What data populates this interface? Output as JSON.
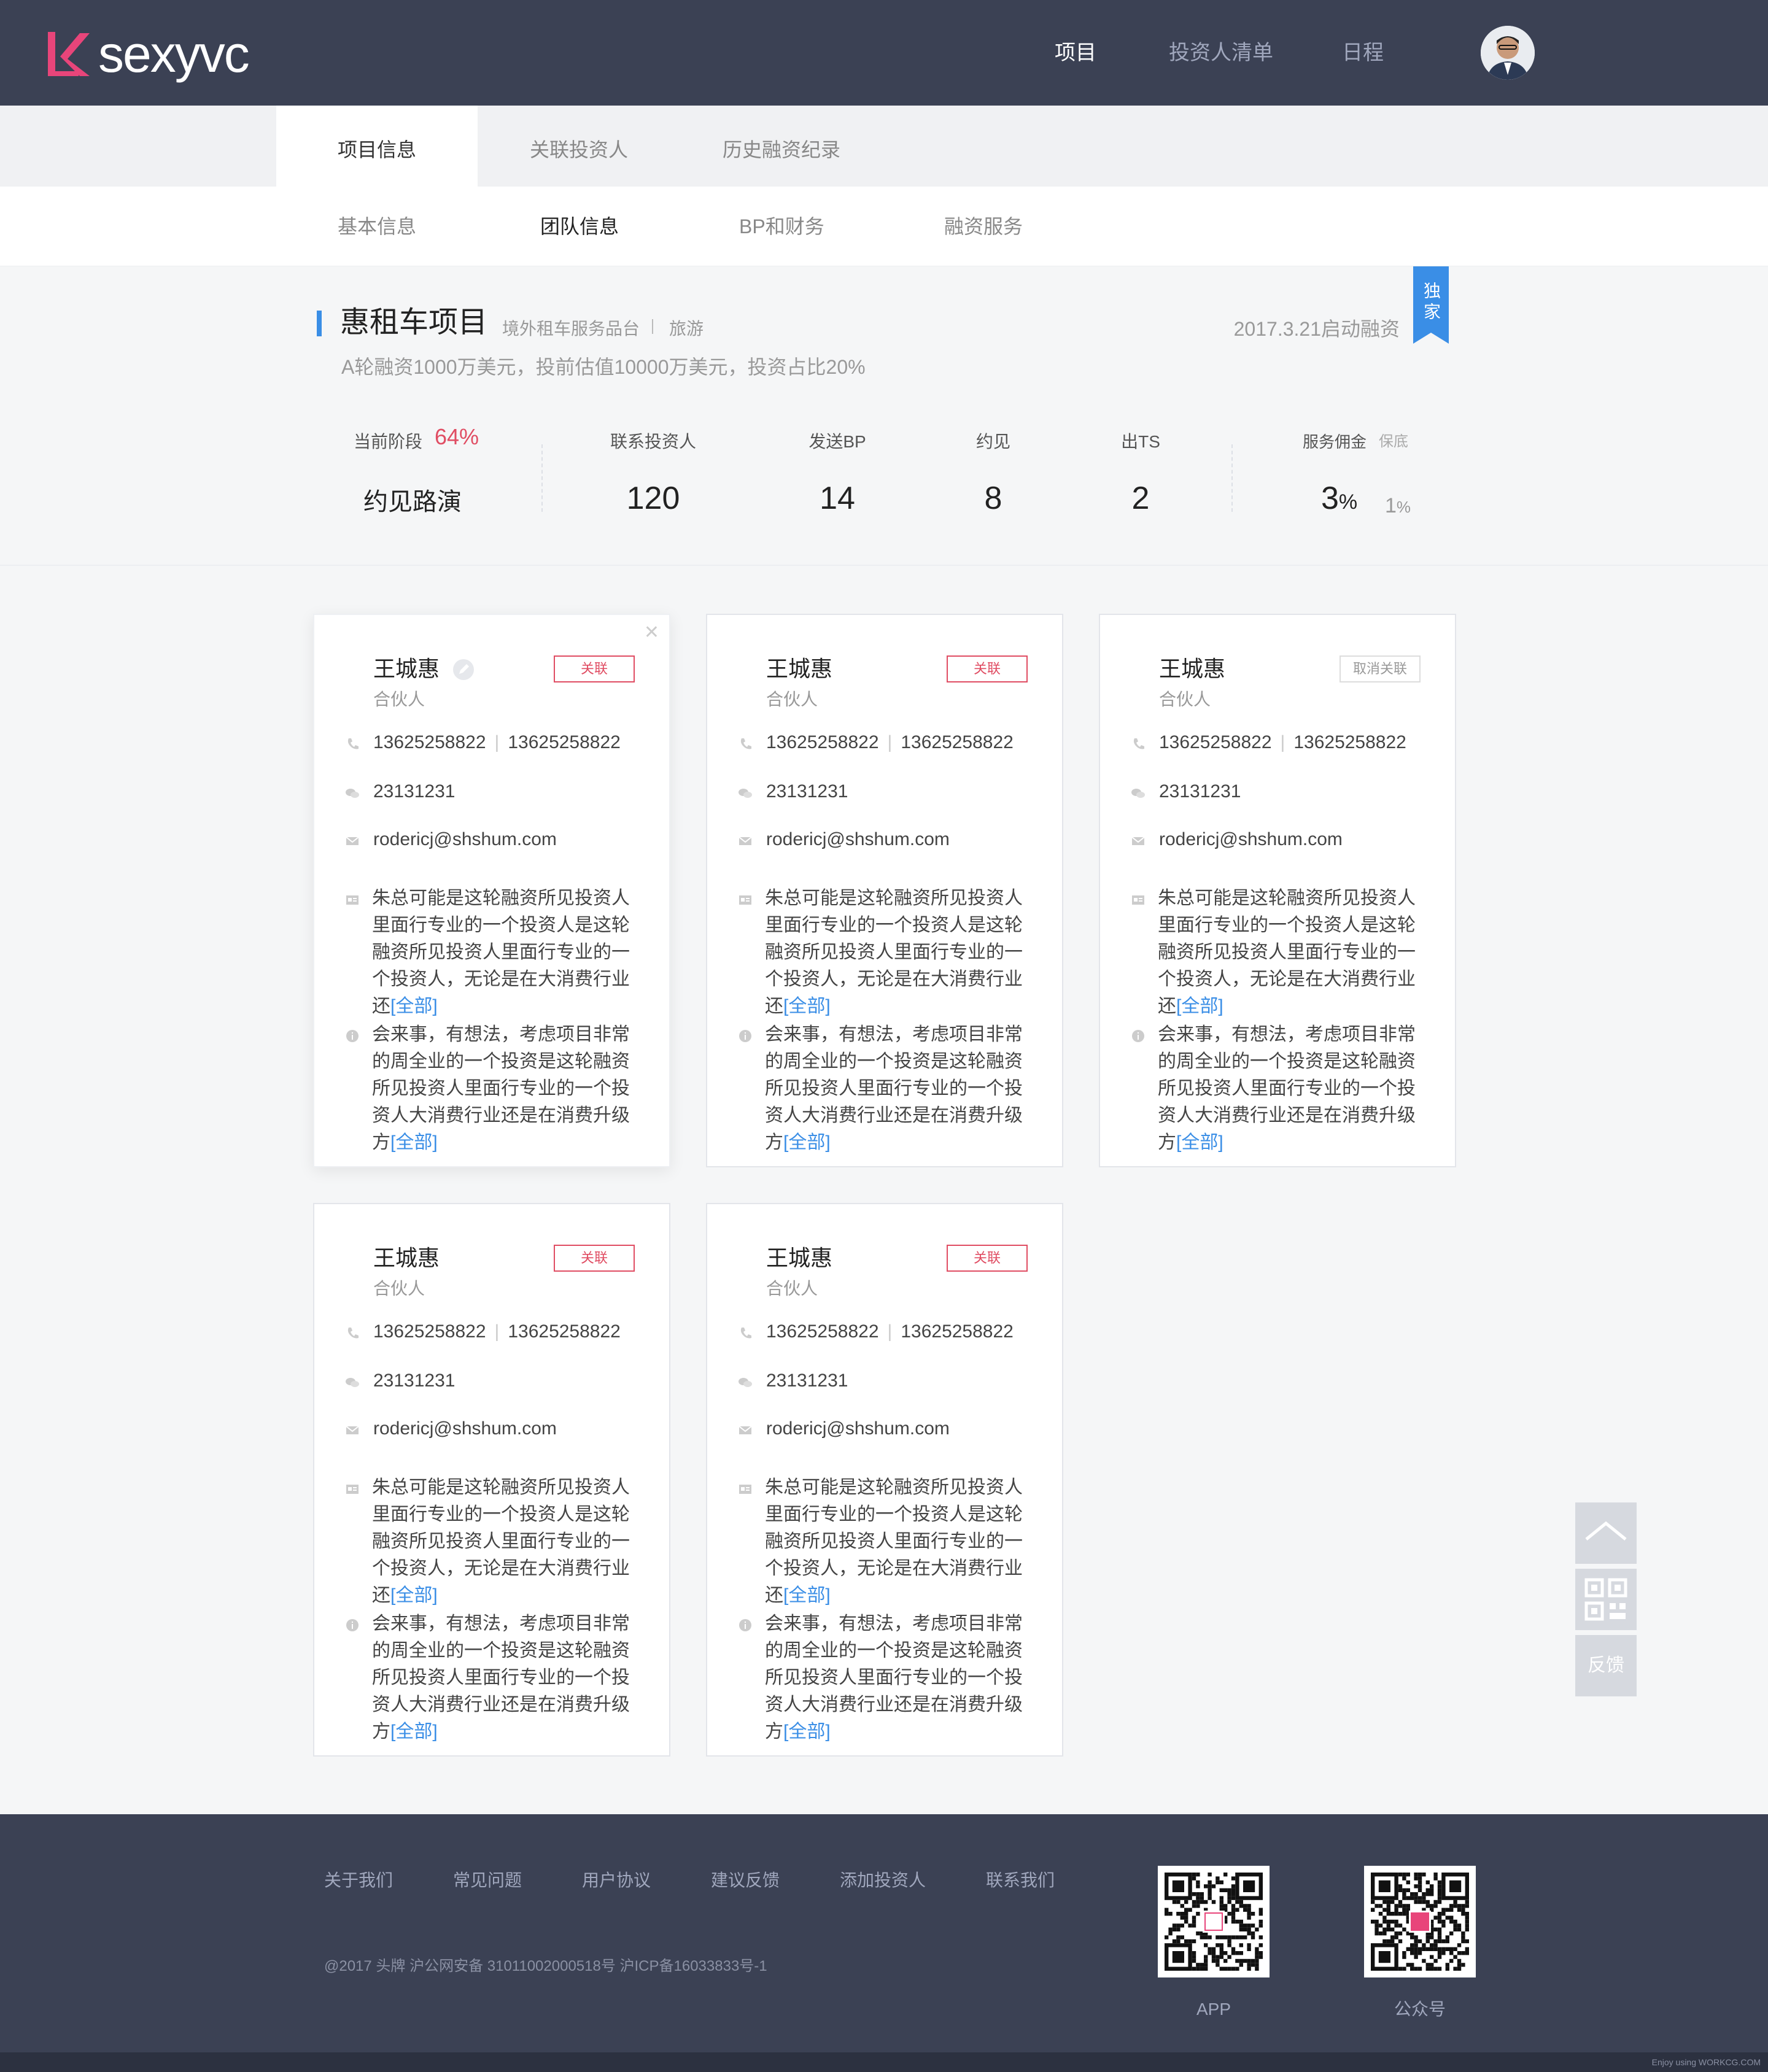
{
  "header": {
    "logo_text": "sexyvc",
    "nav": [
      "项目",
      "投资人清单",
      "日程"
    ]
  },
  "tabs_main": [
    "项目信息",
    "关联投资人",
    "历史融资纪录"
  ],
  "tabs_sub": [
    "基本信息",
    "团队信息",
    "BP和财务",
    "融资服务"
  ],
  "project": {
    "title": "惠租车项目",
    "category": "境外租车服务品台",
    "tag": "旅游",
    "desc": "A轮融资1000万美元，投前估值10000万美元，投资占比20%",
    "start_date": "2017.3.21启动融资",
    "badge": "独家",
    "stage_label": "当前阶段",
    "stage_pct": "64%",
    "stage_value": "约见路演",
    "stats": [
      {
        "label": "联系投资人",
        "value": "120"
      },
      {
        "label": "发送BP",
        "value": "14"
      },
      {
        "label": "约见",
        "value": "8"
      },
      {
        "label": "出TS",
        "value": "2"
      }
    ],
    "commission_label": "服务佣金",
    "commission_guarantee_label": "保底",
    "commission_value": "3",
    "commission_unit": "%",
    "commission_guarantee_value": "1",
    "commission_guarantee_unit": "%"
  },
  "cards": [
    {
      "name": "王城惠",
      "role": "合伙人",
      "button": "关联",
      "phone1": "13625258822",
      "phone2": "13625258822",
      "wechat": "23131231",
      "email": "rodericj@shshum.com",
      "bio": "朱总可能是这轮融资所见投资人里面行专业的一个投资人是这轮融资所见投资人里面行专业的一个投资人，无论是在大消费行业还",
      "note": "会来事，有想法，考虑项目非常的周全业的一个投资是这轮融资所见投资人里面行专业的一个投资人大消费行业还是在消费升级方",
      "more": "[全部]"
    },
    {
      "name": "王城惠",
      "role": "合伙人",
      "button": "关联",
      "phone1": "13625258822",
      "phone2": "13625258822",
      "wechat": "23131231",
      "email": "rodericj@shshum.com",
      "bio": "朱总可能是这轮融资所见投资人里面行专业的一个投资人是这轮融资所见投资人里面行专业的一个投资人，无论是在大消费行业还",
      "note": "会来事，有想法，考虑项目非常的周全业的一个投资是这轮融资所见投资人里面行专业的一个投资人大消费行业还是在消费升级方",
      "more": "[全部]"
    },
    {
      "name": "王城惠",
      "role": "合伙人",
      "button": "取消关联",
      "phone1": "13625258822",
      "phone2": "13625258822",
      "wechat": "23131231",
      "email": "rodericj@shshum.com",
      "bio": "朱总可能是这轮融资所见投资人里面行专业的一个投资人是这轮融资所见投资人里面行专业的一个投资人，无论是在大消费行业还",
      "note": "会来事，有想法，考虑项目非常的周全业的一个投资是这轮融资所见投资人里面行专业的一个投资人大消费行业还是在消费升级方",
      "more": "[全部]"
    },
    {
      "name": "王城惠",
      "role": "合伙人",
      "button": "关联",
      "phone1": "13625258822",
      "phone2": "13625258822",
      "wechat": "23131231",
      "email": "rodericj@shshum.com",
      "bio": "朱总可能是这轮融资所见投资人里面行专业的一个投资人是这轮融资所见投资人里面行专业的一个投资人，无论是在大消费行业还",
      "note": "会来事，有想法，考虑项目非常的周全业的一个投资是这轮融资所见投资人里面行专业的一个投资人大消费行业还是在消费升级方",
      "more": "[全部]"
    },
    {
      "name": "王城惠",
      "role": "合伙人",
      "button": "关联",
      "phone1": "13625258822",
      "phone2": "13625258822",
      "wechat": "23131231",
      "email": "rodericj@shshum.com",
      "bio": "朱总可能是这轮融资所见投资人里面行专业的一个投资人是这轮融资所见投资人里面行专业的一个投资人，无论是在大消费行业还",
      "note": "会来事，有想法，考虑项目非常的周全业的一个投资是这轮融资所见投资人里面行专业的一个投资人大消费行业还是在消费升级方",
      "more": "[全部]"
    }
  ],
  "float_tools": {
    "feedback": "反馈"
  },
  "footer": {
    "links": [
      "关于我们",
      "常见问题",
      "用户协议",
      "建议反馈",
      "添加投资人",
      "联系我们"
    ],
    "copyright": "@2017 头牌  沪公网安备 31011002000518号 沪ICP备16033833号-1",
    "qr_labels": [
      "APP",
      "公众号"
    ],
    "watermark": "Enjoy using WORKCG.COM"
  },
  "colors": {
    "header_bg": "#3b4154",
    "accent_red": "#e04d63",
    "accent_blue": "#3a8ee6"
  }
}
